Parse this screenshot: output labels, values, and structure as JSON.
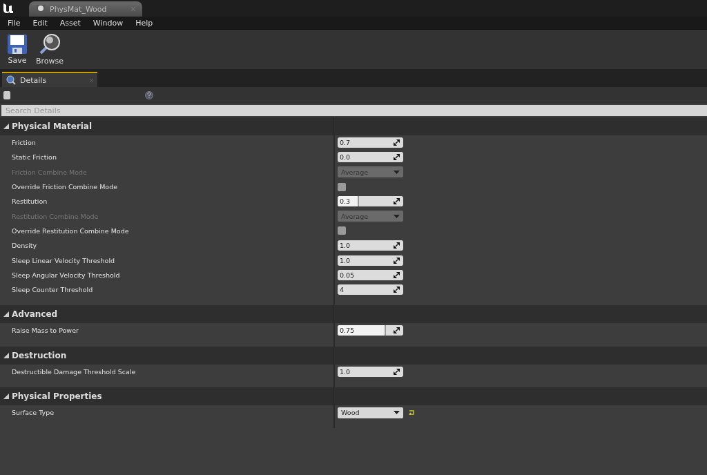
{
  "window": {
    "tab_title": "PhysMat_Wood"
  },
  "menu": [
    "File",
    "Edit",
    "Asset",
    "Window",
    "Help"
  ],
  "toolbar": [
    {
      "kind": "save",
      "label": "Save"
    },
    {
      "kind": "browse",
      "label": "Browse"
    }
  ],
  "panel_tab": {
    "label": "Details"
  },
  "search": {
    "placeholder": "Search Details"
  },
  "categories": [
    {
      "title": "Physical Material",
      "expanded": true,
      "properties": [
        {
          "label": "Friction",
          "kind": "number",
          "value": "0.7",
          "disabled": false
        },
        {
          "label": "Static Friction",
          "kind": "number",
          "value": "0.0",
          "disabled": false
        },
        {
          "label": "Friction Combine Mode",
          "kind": "combo",
          "value": "Average",
          "disabled": true
        },
        {
          "label": "Override Friction Combine Mode",
          "kind": "checkbox",
          "checked": false,
          "disabled": false
        },
        {
          "label": "Restitution",
          "kind": "slider",
          "value": "0.3",
          "level": 0.3,
          "disabled": false
        },
        {
          "label": "Restitution Combine Mode",
          "kind": "combo",
          "value": "Average",
          "disabled": true
        },
        {
          "label": "Override Restitution Combine Mode",
          "kind": "checkbox",
          "checked": false,
          "disabled": false
        },
        {
          "label": "Density",
          "kind": "number",
          "value": "1.0",
          "disabled": false
        },
        {
          "label": "Sleep Linear Velocity Threshold",
          "kind": "number",
          "value": "1.0",
          "disabled": false
        },
        {
          "label": "Sleep Angular Velocity Threshold",
          "kind": "number",
          "value": "0.05",
          "disabled": false
        },
        {
          "label": "Sleep Counter Threshold",
          "kind": "number",
          "value": "4",
          "disabled": false
        }
      ]
    },
    {
      "title": "Advanced",
      "expanded": true,
      "properties": [
        {
          "label": "Raise Mass to Power",
          "kind": "slider",
          "value": "0.75",
          "level": 0.72,
          "disabled": false
        }
      ]
    },
    {
      "title": "Destruction",
      "expanded": true,
      "properties": [
        {
          "label": "Destructible Damage Threshold Scale",
          "kind": "number",
          "value": "1.0",
          "disabled": false
        }
      ]
    },
    {
      "title": "Physical Properties",
      "expanded": true,
      "properties": [
        {
          "label": "Surface Type",
          "kind": "combo",
          "value": "Wood",
          "disabled": false,
          "resettable": true
        }
      ]
    }
  ]
}
